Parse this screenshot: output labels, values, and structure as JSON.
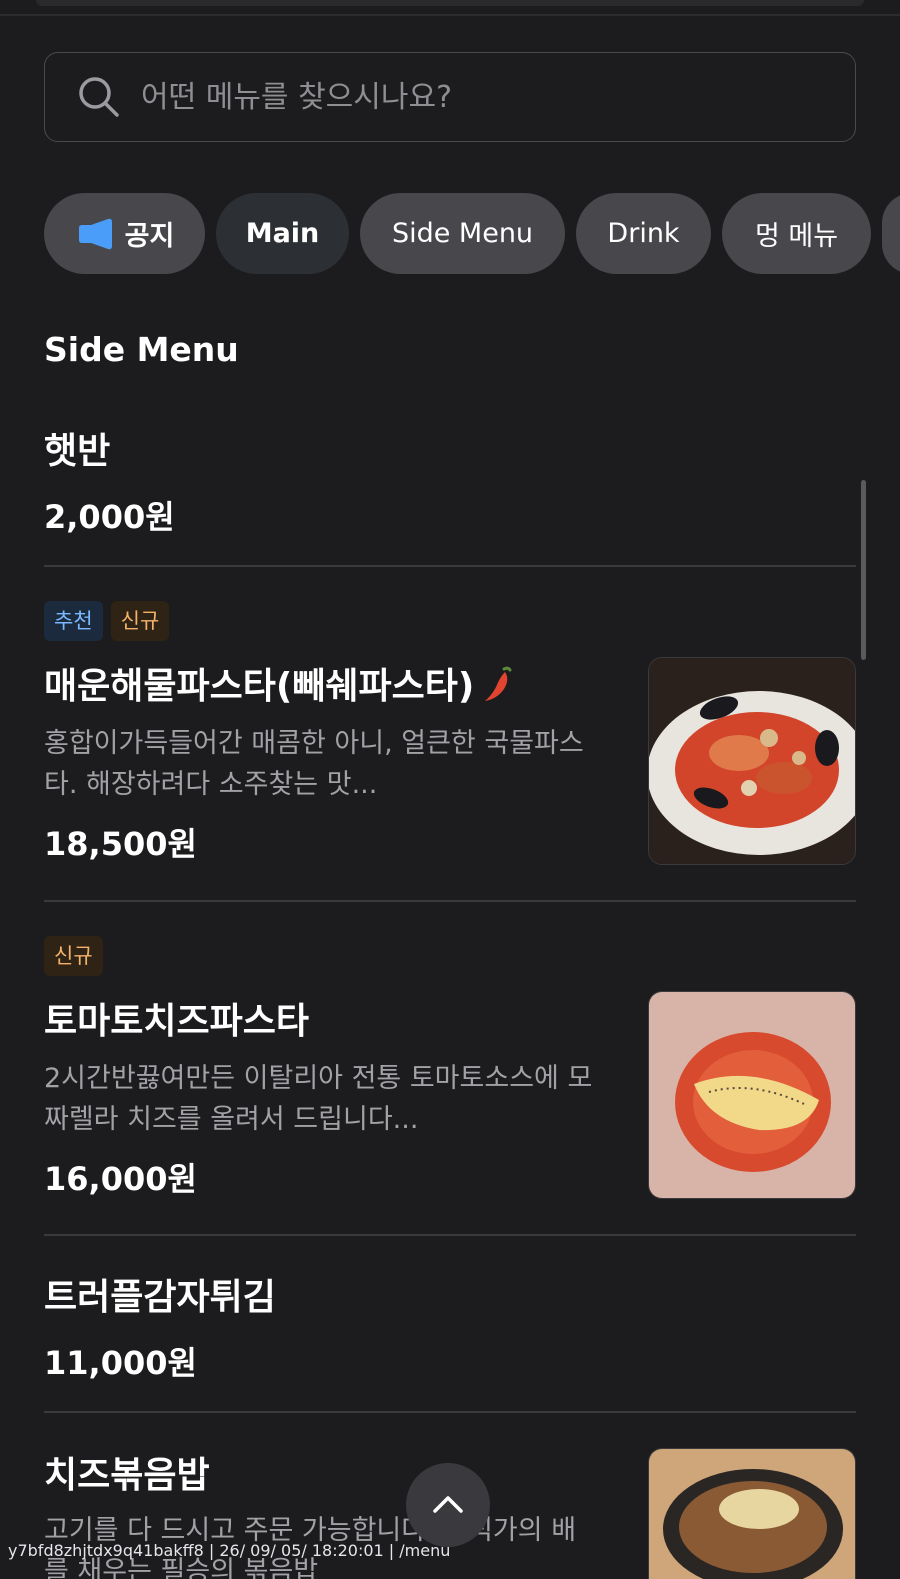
{
  "search": {
    "placeholder": "어떤 메뉴를 찾으시나요?"
  },
  "categories": {
    "notice": "공지",
    "main": "Main",
    "side_menu": "Side Menu",
    "drink": "Drink",
    "dog_menu": "멍 메뉴"
  },
  "section": {
    "title": "Side Menu"
  },
  "items": [
    {
      "name": "햇반",
      "price": "2,000원"
    },
    {
      "badges": [
        "추천",
        "신규"
      ],
      "name": "매운해물파스타(빼쉐파스타)",
      "desc": "홍합이가득들어간 매콤한 아니, 얼큰한 국물파스타. 해장하려다 소주찾는 맛...",
      "price": "18,500원"
    },
    {
      "badges": [
        "신규"
      ],
      "name": "토마토치즈파스타",
      "desc": "2시간반끓여만든 이탈리아 전통 토마토소스에 모짜렐라 치즈를 올려서 드립니다...",
      "price": "16,000원"
    },
    {
      "name": "트러플감자튀김",
      "price": "11,000원"
    },
    {
      "name": "치즈볶음밥",
      "desc": "고기를 다 드시고 주문 가능합니다. 대식가의 배를 채우는 필승의 볶음밥"
    }
  ],
  "footer": {
    "text": "y7bfd8zhjtdx9q41bakff8 | 26/ 09/ 05/ 18:20:01 | /menu"
  },
  "colors": {
    "background": "#1c1c1e",
    "accent_blue": "#4a9df8",
    "badge_new": "#f5b26b",
    "badge_recommend": "#7ab8ff"
  },
  "icons": {
    "search": "search-icon",
    "notice": "megaphone-icon",
    "spicy": "chili-pepper-icon",
    "scroll_top": "chevron-up-icon"
  }
}
